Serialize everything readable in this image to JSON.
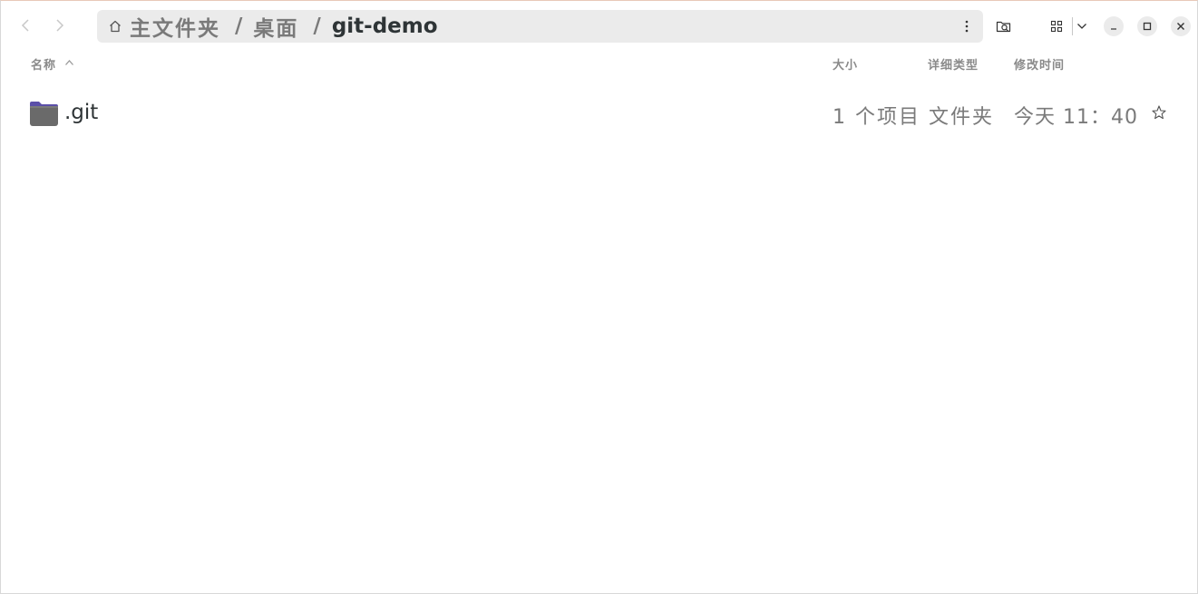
{
  "window": {
    "path": {
      "crumbs": [
        "主文件夹",
        "桌面",
        "git-demo"
      ],
      "separator": "/"
    }
  },
  "columns": {
    "name": "名称",
    "size": "大小",
    "type": "详细类型",
    "modified": "修改时间"
  },
  "files": [
    {
      "name": ".git",
      "size": "1 个项目",
      "type": "文件夹",
      "modified": "今天 11：40",
      "icon": "folder-icon",
      "starred": false
    }
  ],
  "colors": {
    "folder": "#5b4fa8",
    "folder_body": "#6a6a6a",
    "pathbar_bg": "#ebebeb",
    "text_primary": "#2e3436",
    "text_secondary": "#7a7a7a"
  }
}
